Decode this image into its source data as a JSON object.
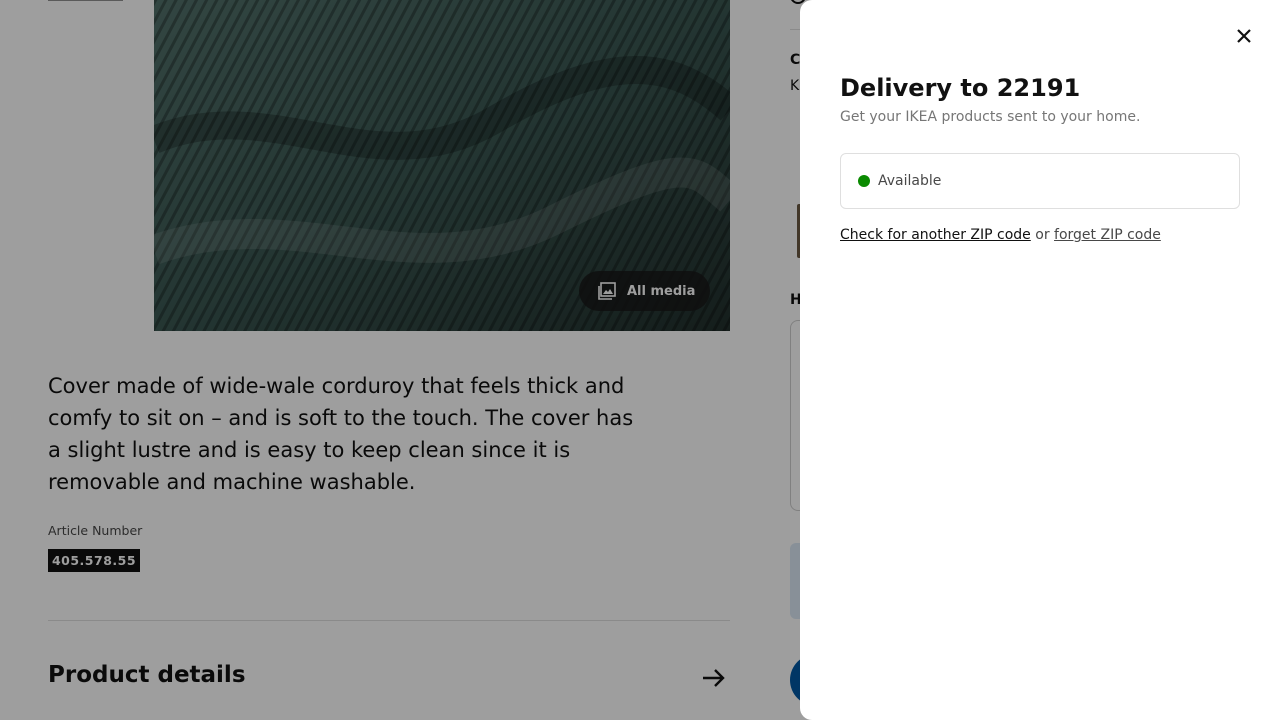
{
  "background": {
    "all_media_label": "All media",
    "description": "Cover made of wide-wale corduroy that feels thick and comfy to sit on – and is soft to the touch. The cover has a slight lustre and is easy to keep clean since it is removable and machine washable.",
    "article_label": "Article Number",
    "article_number": "405.578.55",
    "product_details_title": "Product details",
    "right_col_c": "C",
    "right_col_k": "K",
    "right_col_h": "H"
  },
  "modal": {
    "title": "Delivery to 22191",
    "subtitle": "Get your IKEA products sent to your home.",
    "status_label": "Available",
    "status_color": "#0a8a00",
    "check_link": "Check for another ZIP code",
    "or_text": "or",
    "forget_link": "forget ZIP code"
  },
  "icons": {
    "close": "close-icon",
    "media": "media-gallery-icon",
    "arrow": "arrow-right-icon"
  }
}
